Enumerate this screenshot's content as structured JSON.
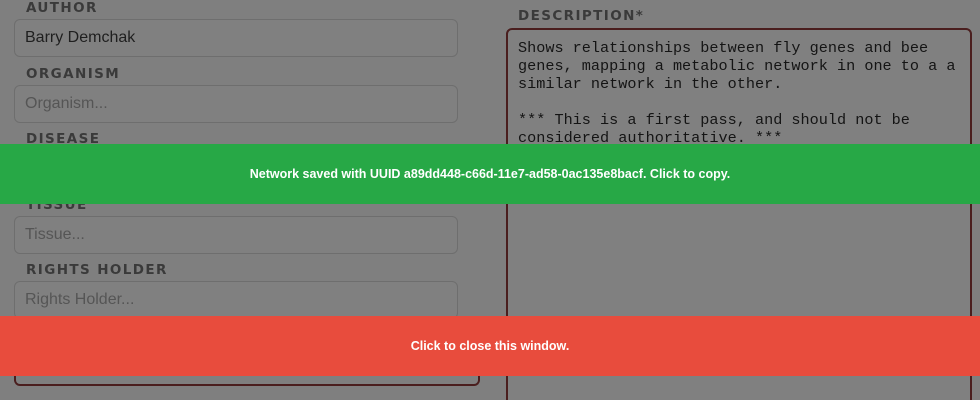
{
  "form": {
    "author": {
      "label": "AUTHOR",
      "value": "Barry Demchak",
      "placeholder": ""
    },
    "organism": {
      "label": "ORGANISM",
      "value": "",
      "placeholder": "Organism..."
    },
    "disease": {
      "label": "DISEASE"
    },
    "tissue": {
      "label": "TISSUE",
      "value": "",
      "placeholder": "Tissue..."
    },
    "rights_holder": {
      "label": "RIGHTS HOLDER",
      "value": "",
      "placeholder": "Rights Holder..."
    }
  },
  "description": {
    "label": "DESCRIPTION*",
    "value": "Shows relationships between fly genes and bee genes, mapping a metabolic network in one to a a similar network in the other.\n\n*** This is a first pass, and should not be considered authoritative. ***"
  },
  "notifications": {
    "saved": "Network saved with UUID a89dd448-c66d-11e7-ad58-0ac135e8bacf. Click to copy.",
    "close": "Click to close this window."
  },
  "colors": {
    "success": "#27a846",
    "danger": "#e84c3d",
    "overlay": "#7f7f7f"
  }
}
